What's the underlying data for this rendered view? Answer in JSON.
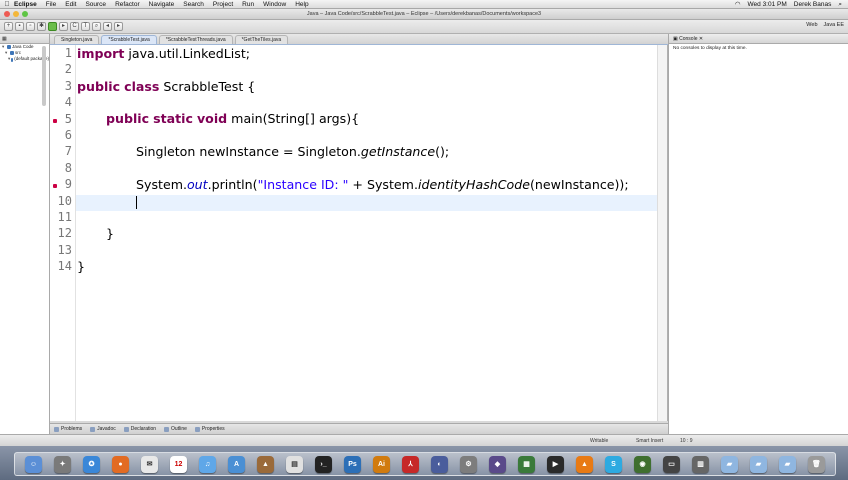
{
  "menubar": {
    "apple": "",
    "app": "Eclipse",
    "items": [
      "File",
      "Edit",
      "Source",
      "Refactor",
      "Navigate",
      "Search",
      "Project",
      "Run",
      "Window",
      "Help"
    ],
    "clock": "Wed 3:01 PM",
    "user": "Derek Banas"
  },
  "window": {
    "title": "Java – Java Code/src/ScrabbleTest.java – Eclipse – /Users/derekbanas/Documents/workspace3"
  },
  "perspectives": [
    "Web",
    "Java EE"
  ],
  "explorer": {
    "rows": [
      "Java Code",
      "src",
      "(default package)"
    ]
  },
  "editor": {
    "tabs": [
      {
        "label": "Singleton.java",
        "active": false
      },
      {
        "label": "*ScrabbleTest.java",
        "active": true
      },
      {
        "label": "*ScrabbleTestThreads.java",
        "active": false
      },
      {
        "label": "*GetTheTiles.java",
        "active": false
      }
    ],
    "line_numbers": [
      "1",
      "2",
      "3",
      "4",
      "5",
      "6",
      "7",
      "8",
      "9",
      "10",
      "11",
      "12",
      "13",
      "14"
    ]
  },
  "bottom_views": [
    "Problems",
    "Javadoc",
    "Declaration",
    "Outline",
    "Properties"
  ],
  "console": {
    "title": "Console",
    "message": "No consoles to display at this time."
  },
  "status": {
    "writable": "Writable",
    "insert_mode": "Smart Insert",
    "position": "10 : 9"
  }
}
